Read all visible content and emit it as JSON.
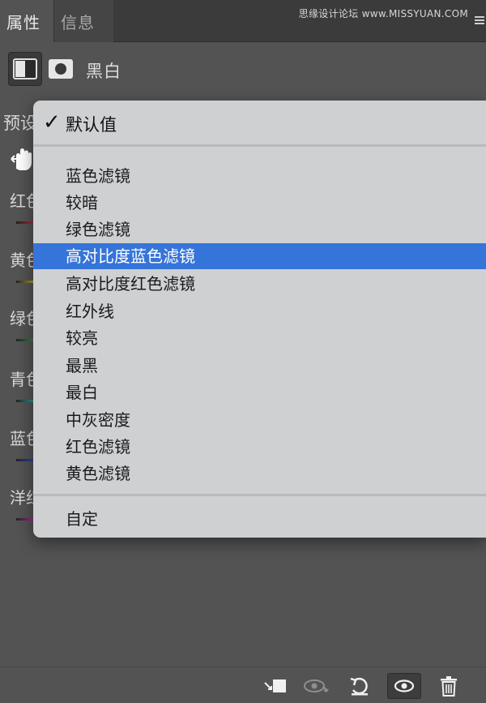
{
  "tabs": [
    {
      "label": "属性"
    },
    {
      "label": "信息"
    }
  ],
  "watermark": "思缘设计论坛 www.MISSYUAN.COM",
  "adjustment": {
    "title": "黑白",
    "adjustment_icon": "black-white-adjustment-icon",
    "mask_icon": "layer-mask-icon"
  },
  "preset_label": "预设",
  "background_sliders": [
    {
      "label": "红色",
      "color": "#cc2a3a"
    },
    {
      "label": "黄色",
      "color": "#c8b52a"
    },
    {
      "label": "绿色",
      "color": "#2aa04a"
    },
    {
      "label": "青色",
      "color": "#2ab0b0"
    },
    {
      "label": "蓝色",
      "color": "#2a4ad0"
    },
    {
      "label": "洋红",
      "color": "#c02ab0"
    }
  ],
  "dropdown": {
    "default_item": "默认值",
    "items": [
      {
        "label": "蓝色滤镜",
        "selected": false
      },
      {
        "label": "较暗",
        "selected": false
      },
      {
        "label": "绿色滤镜",
        "selected": false
      },
      {
        "label": "高对比度蓝色滤镜",
        "selected": true
      },
      {
        "label": "高对比度红色滤镜",
        "selected": false
      },
      {
        "label": "红外线",
        "selected": false
      },
      {
        "label": "较亮",
        "selected": false
      },
      {
        "label": "最黑",
        "selected": false
      },
      {
        "label": "最白",
        "selected": false
      },
      {
        "label": "中灰密度",
        "selected": false
      },
      {
        "label": "红色滤镜",
        "selected": false
      },
      {
        "label": "黄色滤镜",
        "selected": false
      }
    ],
    "custom_item": "自定",
    "highlight_color": "#3574d9"
  },
  "toolbar_icons": [
    "clip-to-layer-icon",
    "view-previous-state-icon",
    "reset-icon",
    "visibility-eye-icon",
    "trash-icon"
  ]
}
